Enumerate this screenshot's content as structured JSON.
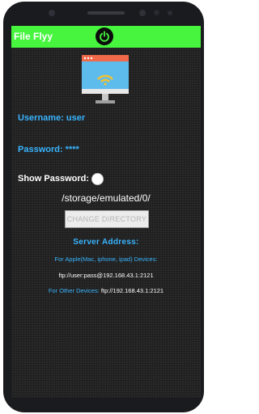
{
  "app": {
    "title": "File Flyy"
  },
  "credentials": {
    "username_text": "Username: user",
    "password_text": "Password: ****",
    "show_password_label": "Show Password:"
  },
  "directory": {
    "path": "/storage/emulated/0/",
    "change_button_label": "CHANGE DIRECTORY"
  },
  "server": {
    "label": "Server Address:",
    "apple_label": "For Apple(Mac, iphone, ipad) Devices:",
    "apple_url": "ftp://user:pass@192.168.43.1:2121",
    "other_label": "For Other Devices:",
    "other_url": " ftp://192.168.43.1:2121"
  },
  "colors": {
    "topbar": "#47f53f",
    "accent_blue": "#38b4ff",
    "background": "#2a2a2a"
  },
  "icons": {
    "power": "power-icon",
    "monitor": "monitor-wifi-icon",
    "toggle": "toggle-off-icon"
  }
}
